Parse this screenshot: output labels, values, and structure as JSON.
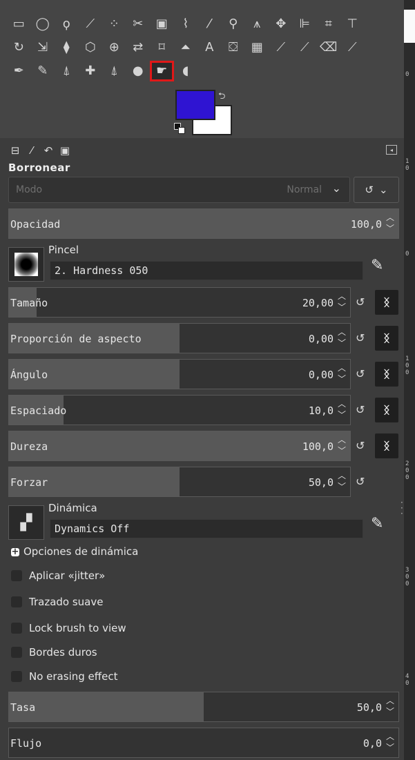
{
  "toolbox": {
    "rows": [
      [
        {
          "name": "rect-select-icon",
          "glyph": "▭"
        },
        {
          "name": "ellipse-select-icon",
          "glyph": "◯"
        },
        {
          "name": "free-select-icon",
          "glyph": "ϙ"
        },
        {
          "name": "fuzzy-select-icon",
          "glyph": "⟋"
        },
        {
          "name": "select-by-color-icon",
          "glyph": "⁘"
        },
        {
          "name": "scissors-select-icon",
          "glyph": "✂"
        },
        {
          "name": "foreground-select-icon",
          "glyph": "▣"
        },
        {
          "name": "paths-tool-icon",
          "glyph": "⌇"
        },
        {
          "name": "color-picker-icon",
          "glyph": "⁄"
        },
        {
          "name": "zoom-tool-icon",
          "glyph": "⚲"
        },
        {
          "name": "measure-tool-icon",
          "glyph": "⩚"
        },
        {
          "name": "move-tool-icon",
          "glyph": "✥"
        },
        {
          "name": "align-tool-icon",
          "glyph": "⊫"
        },
        {
          "name": "crop-tool-icon",
          "glyph": "⌗"
        },
        {
          "name": "unified-transform-icon",
          "glyph": "⊤"
        }
      ],
      [
        {
          "name": "rotate-tool-icon",
          "glyph": "↻"
        },
        {
          "name": "scale-tool-icon",
          "glyph": "⇲"
        },
        {
          "name": "shear-tool-icon",
          "glyph": "⧫"
        },
        {
          "name": "perspective-tool-icon",
          "glyph": "⬡"
        },
        {
          "name": "3d-transform-icon",
          "glyph": "⊕"
        },
        {
          "name": "flip-tool-icon",
          "glyph": "⇄"
        },
        {
          "name": "cage-transform-icon",
          "glyph": "⌑"
        },
        {
          "name": "warp-transform-icon",
          "glyph": "⏶"
        },
        {
          "name": "text-tool-icon",
          "glyph": "A"
        },
        {
          "name": "bucket-fill-icon",
          "glyph": "⛋"
        },
        {
          "name": "gradient-tool-icon",
          "glyph": "▦"
        },
        {
          "name": "pencil-tool-icon",
          "glyph": "⟋"
        },
        {
          "name": "paintbrush-tool-icon",
          "glyph": "⟋"
        },
        {
          "name": "eraser-tool-icon",
          "glyph": "⌫"
        },
        {
          "name": "airbrush-tool-icon",
          "glyph": "⟋"
        }
      ],
      [
        {
          "name": "ink-tool-icon",
          "glyph": "✒"
        },
        {
          "name": "mypaint-brush-icon",
          "glyph": "✎"
        },
        {
          "name": "clone-tool-icon",
          "glyph": "⍋"
        },
        {
          "name": "heal-tool-icon",
          "glyph": "✚"
        },
        {
          "name": "perspective-clone-icon",
          "glyph": "⍋"
        },
        {
          "name": "blur-sharpen-icon",
          "glyph": "●"
        },
        {
          "name": "smudge-tool-icon",
          "glyph": "☛"
        },
        {
          "name": "dodge-burn-icon",
          "glyph": "◖"
        }
      ]
    ],
    "selected_tool": "smudge-tool-icon",
    "fg_color": "#2f14d2",
    "bg_color": "#ffffff"
  },
  "dock": {
    "tabs": [
      {
        "name": "tab-tool-options",
        "glyph": "⊟"
      },
      {
        "name": "tab-device-status",
        "glyph": "⁄"
      },
      {
        "name": "tab-undo-history",
        "glyph": "↶"
      },
      {
        "name": "tab-images",
        "glyph": "▣"
      }
    ]
  },
  "options": {
    "title": "Borronear",
    "mode_label": "Modo",
    "mode_value": "Normal",
    "opacity": {
      "label": "Opacidad",
      "value": "100,0",
      "fill": 1.0
    },
    "brush": {
      "caption": "Pincel",
      "name": "2. Hardness 050"
    },
    "size": {
      "label": "Tamaño",
      "value": "20,00",
      "fill": 0.08
    },
    "aspect": {
      "label": "Proporción de aspecto",
      "value": "0,00",
      "fill": 0.5
    },
    "angle": {
      "label": "Ángulo",
      "value": "0,00",
      "fill": 0.5
    },
    "spacing": {
      "label": "Espaciado",
      "value": "10,0",
      "fill": 0.16
    },
    "hardness": {
      "label": "Dureza",
      "value": "100,0",
      "fill": 1.0
    },
    "force": {
      "label": "Forzar",
      "value": "50,0",
      "fill": 0.5
    },
    "dynamics": {
      "caption": "Dinámica",
      "name": "Dynamics Off"
    },
    "dynamics_options_label": "Opciones de dinámica",
    "checks": {
      "jitter": "Aplicar «jitter»",
      "smooth": "Trazado suave",
      "lock": "Lock brush to view",
      "hard_edges": "Bordes duros",
      "no_erasing": "No erasing effect"
    },
    "rate": {
      "label": "Tasa",
      "value": "50,0",
      "fill": 0.5
    },
    "flow": {
      "label": "Flujo",
      "value": "0,0",
      "fill": 0.0
    }
  },
  "ruler": {
    "marks": [
      "0",
      "1",
      "0",
      "0",
      "1",
      "0",
      "0",
      "2",
      "0",
      "0",
      "3",
      "0",
      "0",
      "4",
      "0"
    ]
  }
}
